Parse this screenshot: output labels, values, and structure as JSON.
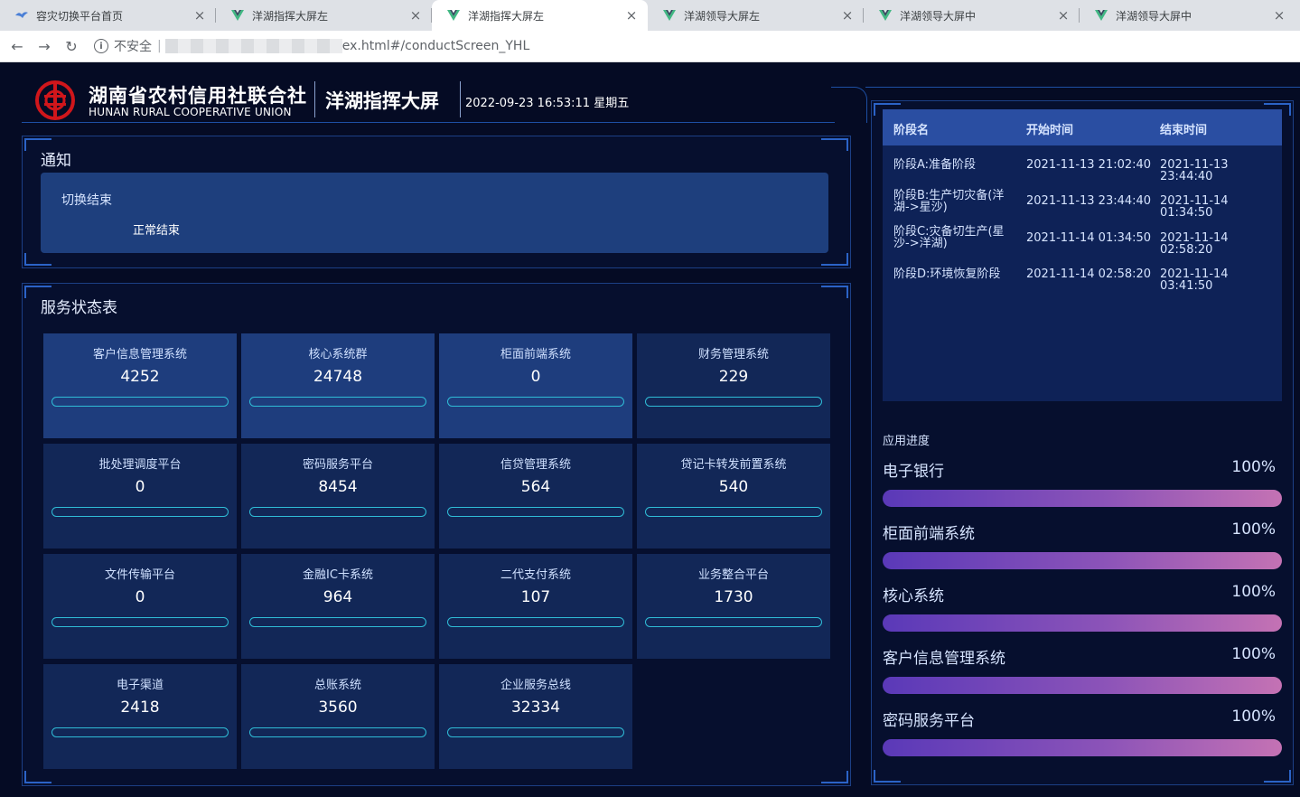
{
  "browser": {
    "tabs": [
      {
        "label": "容灾切换平台首页",
        "icon": "bird-icon",
        "active": false
      },
      {
        "label": "洋湖指挥大屏左",
        "icon": "vue-icon",
        "active": false
      },
      {
        "label": "洋湖指挥大屏左",
        "icon": "vue-icon",
        "active": true
      },
      {
        "label": "洋湖领导大屏左",
        "icon": "vue-icon",
        "active": false
      },
      {
        "label": "洋湖领导大屏中",
        "icon": "vue-icon",
        "active": false
      },
      {
        "label": "洋湖领导大屏中",
        "icon": "vue-icon",
        "active": false
      }
    ],
    "security_label": "不安全",
    "url": "ex.html#/conductScreen_YHL"
  },
  "header": {
    "org_name": "湖南省农村信用社联合社",
    "org_name_en": "HUNAN RURAL COOPERATIVE UNION",
    "screen_title": "洋湖指挥大屏",
    "datetime": "2022-09-23 16:53:11 星期五"
  },
  "notice": {
    "title": "通知",
    "item_title": "切换结束",
    "item_text": "正常结束"
  },
  "services": {
    "title": "服务状态表",
    "items": [
      {
        "name": "客户信息管理系统",
        "value": "4252",
        "highlight": true
      },
      {
        "name": "核心系统群",
        "value": "24748",
        "highlight": true
      },
      {
        "name": "柜面前端系统",
        "value": "0",
        "highlight": true
      },
      {
        "name": "财务管理系统",
        "value": "229",
        "highlight": false
      },
      {
        "name": "批处理调度平台",
        "value": "0",
        "highlight": false
      },
      {
        "name": "密码服务平台",
        "value": "8454",
        "highlight": false
      },
      {
        "name": "信贷管理系统",
        "value": "564",
        "highlight": false
      },
      {
        "name": "贷记卡转发前置系统",
        "value": "540",
        "highlight": false
      },
      {
        "name": "文件传输平台",
        "value": "0",
        "highlight": false
      },
      {
        "name": "金融IC卡系统",
        "value": "964",
        "highlight": false
      },
      {
        "name": "二代支付系统",
        "value": "107",
        "highlight": false
      },
      {
        "name": "业务整合平台",
        "value": "1730",
        "highlight": false
      },
      {
        "name": "电子渠道",
        "value": "2418",
        "highlight": false
      },
      {
        "name": "总账系统",
        "value": "3560",
        "highlight": false
      },
      {
        "name": "企业服务总线",
        "value": "32334",
        "highlight": false
      }
    ]
  },
  "stages": {
    "headers": [
      "阶段名",
      "开始时间",
      "结束时间"
    ],
    "rows": [
      {
        "name": "阶段A:准备阶段",
        "start": "2021-11-13 21:02:40",
        "end": "2021-11-13 23:44:40"
      },
      {
        "name": "阶段B:生产切灾备(洋湖->星沙)",
        "start": "2021-11-13 23:44:40",
        "end": "2021-11-14 01:34:50"
      },
      {
        "name": "阶段C:灾备切生产(星沙->洋湖)",
        "start": "2021-11-14 01:34:50",
        "end": "2021-11-14 02:58:20"
      },
      {
        "name": "阶段D:环境恢复阶段",
        "start": "2021-11-14 02:58:20",
        "end": "2021-11-14 03:41:50"
      }
    ]
  },
  "progress": {
    "title": "应用进度",
    "items": [
      {
        "name": "电子银行",
        "value": "100%",
        "fraction": 1.0
      },
      {
        "name": "柜面前端系统",
        "value": "100%",
        "fraction": 1.0
      },
      {
        "name": "核心系统",
        "value": "100%",
        "fraction": 1.0
      },
      {
        "name": "客户信息管理系统",
        "value": "100%",
        "fraction": 1.0
      },
      {
        "name": "密码服务平台",
        "value": "100%",
        "fraction": 1.0
      }
    ]
  }
}
